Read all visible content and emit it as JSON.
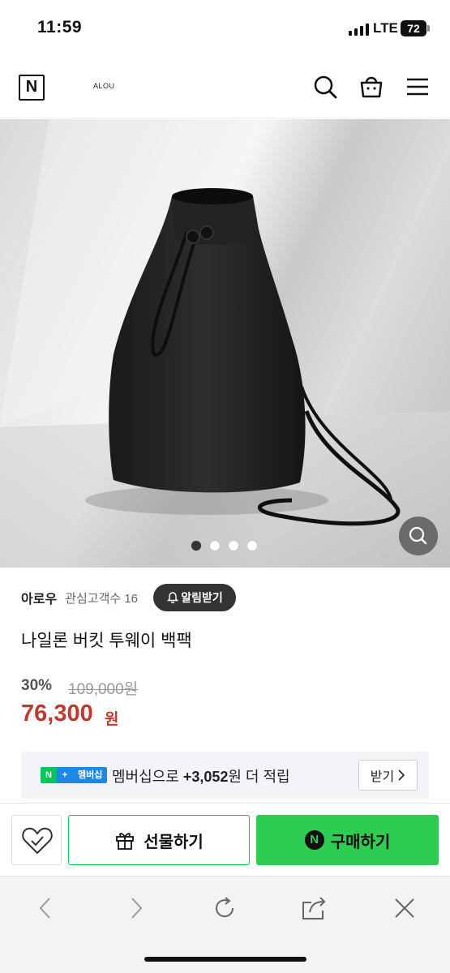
{
  "status_bar": {
    "time": "11:59",
    "network": "LTE",
    "battery": "72"
  },
  "header": {
    "logo": "N",
    "brand": "ALOU"
  },
  "gallery": {
    "image_count": 4,
    "active_index": 0
  },
  "store": {
    "name": "아로우",
    "followers_label": "관심고객수 16",
    "notify_label": "알림받기"
  },
  "product": {
    "title": "나일론 버킷 투웨이 백팩",
    "discount": "30%",
    "original_price": "109,000원",
    "price": "76,300",
    "price_unit": "원"
  },
  "membership": {
    "badge_n": "N",
    "badge_plus": "+",
    "badge_label": "멤버십",
    "text_prefix": "멤버십으로 ",
    "points": "+3,052",
    "text_suffix": "원 더 적립",
    "receive_label": "받기"
  },
  "actions": {
    "gift_label": "선물하기",
    "buy_label": "구매하기",
    "buy_badge": "N"
  },
  "colors": {
    "naver_green": "#03c75a",
    "buy_green": "#2ecc52",
    "price_red": "#c0392b",
    "membership_blue": "#1e88e5"
  },
  "icons": [
    "search-icon",
    "shopping-bag-icon",
    "menu-icon",
    "zoom-icon",
    "bell-icon",
    "wish-heart-icon",
    "gift-icon",
    "back-icon",
    "forward-icon",
    "refresh-icon",
    "share-icon",
    "close-icon"
  ]
}
